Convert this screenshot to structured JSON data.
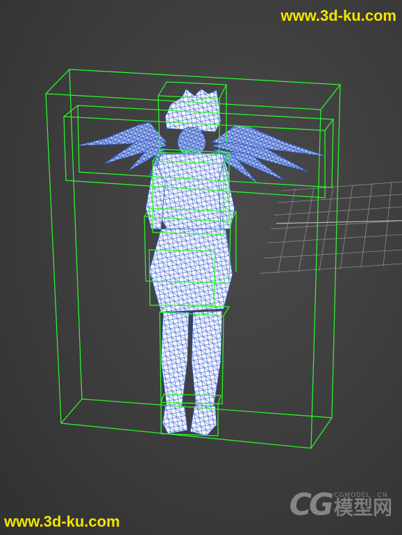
{
  "watermarks": {
    "top": "www.3d-ku.com",
    "bottom": "www.3d-ku.com"
  },
  "logo": {
    "mark": "CG",
    "small_text": "CGMODEL . CN",
    "big_text": "模型网"
  },
  "colors": {
    "background": "#3a3a3a",
    "bounding_box": "#2bff2b",
    "grid": "#9a9a9a",
    "wireframe": "#2a55c8",
    "mesh_fill": "#f4f6ff",
    "watermark": "#f2e600"
  },
  "scene": {
    "object_type": "winged character model",
    "display_mode": "wireframe with bounding boxes"
  }
}
